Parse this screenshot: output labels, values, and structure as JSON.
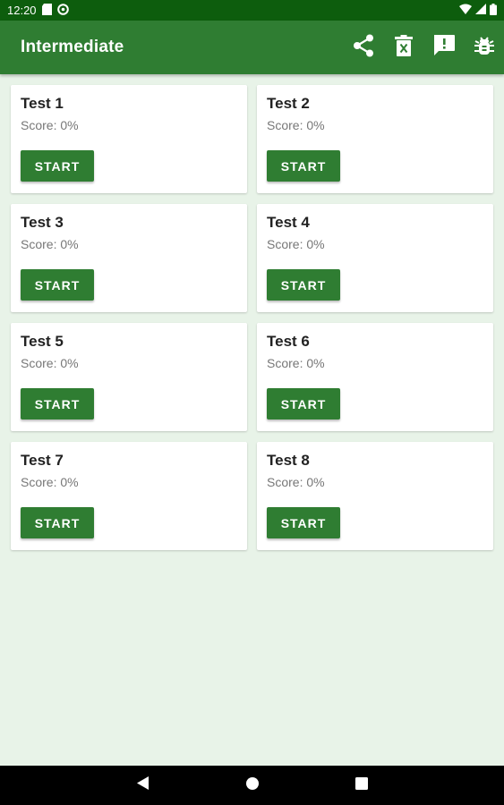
{
  "status_bar": {
    "time": "12:20",
    "icons": [
      "sd-card-icon",
      "data-saver-icon",
      "wifi-icon",
      "signal-icon",
      "battery-icon"
    ]
  },
  "app_bar": {
    "title": "Intermediate",
    "actions": [
      "share-icon",
      "delete-icon",
      "feedback-icon",
      "bug-icon"
    ]
  },
  "tests": [
    {
      "title": "Test 1",
      "score": "Score: 0%",
      "button": "START"
    },
    {
      "title": "Test 2",
      "score": "Score: 0%",
      "button": "START"
    },
    {
      "title": "Test 3",
      "score": "Score: 0%",
      "button": "START"
    },
    {
      "title": "Test 4",
      "score": "Score: 0%",
      "button": "START"
    },
    {
      "title": "Test 5",
      "score": "Score: 0%",
      "button": "START"
    },
    {
      "title": "Test 6",
      "score": "Score: 0%",
      "button": "START"
    },
    {
      "title": "Test 7",
      "score": "Score: 0%",
      "button": "START"
    },
    {
      "title": "Test 8",
      "score": "Score: 0%",
      "button": "START"
    }
  ],
  "nav_bar": {
    "buttons": [
      "back-icon",
      "home-icon",
      "recents-icon"
    ]
  },
  "colors": {
    "status_bar": "#0d5d0d",
    "primary": "#2f7d32",
    "background": "#e8f3e8",
    "card": "#ffffff"
  }
}
